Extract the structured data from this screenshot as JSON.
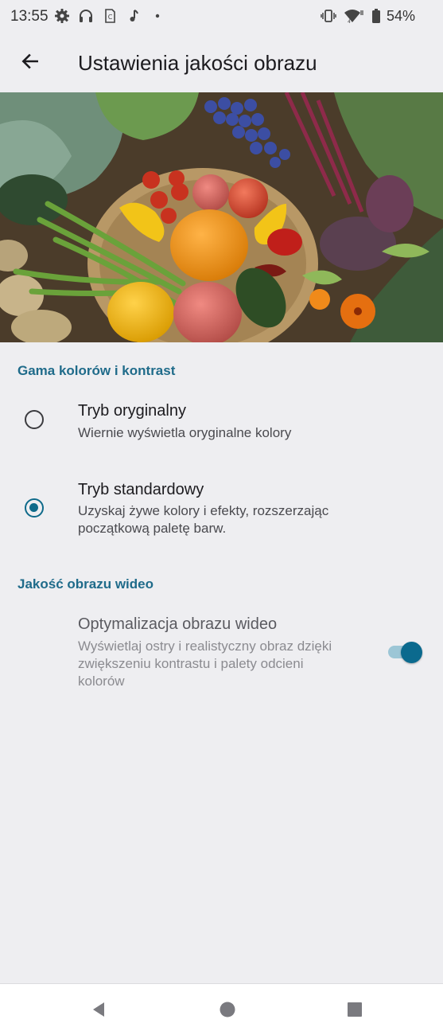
{
  "status_bar": {
    "time": "13:55",
    "battery_percent": "54%",
    "icons": [
      "gear-icon",
      "headphones-icon",
      "sim-card-icon",
      "music-note-icon",
      "dot-icon",
      "vibrate-icon",
      "wifi-icon",
      "battery-icon"
    ]
  },
  "app_bar": {
    "title": "Ustawienia jakości obrazu",
    "back_icon": "arrow-left-icon"
  },
  "hero": {
    "image": "vegetables-photo"
  },
  "sections": {
    "color": {
      "header": "Gama kolorów i kontrast",
      "options": [
        {
          "title": "Tryb oryginalny",
          "summary": "Wiernie wyświetla oryginalne kolory",
          "selected": false
        },
        {
          "title": "Tryb standardowy",
          "summary": "Uzyskaj żywe kolory i efekty, rozszerzając początkową paletę barw.",
          "selected": true
        }
      ]
    },
    "video": {
      "header": "Jakość obrazu wideo",
      "item": {
        "title": "Optymalizacja obrazu wideo",
        "summary": "Wyświetlaj ostry i realistyczny obraz dzięki zwiększeniu kontrastu i palety odcieni kolorów",
        "enabled": true,
        "disabled_look": true
      }
    }
  },
  "nav_bar": {
    "icons": [
      "back-triangle-icon",
      "home-circle-icon",
      "recents-square-icon"
    ]
  },
  "colors": {
    "accent": "#0e6a8a",
    "section_header": "#1f6b8a",
    "background": "#eeeef1"
  }
}
